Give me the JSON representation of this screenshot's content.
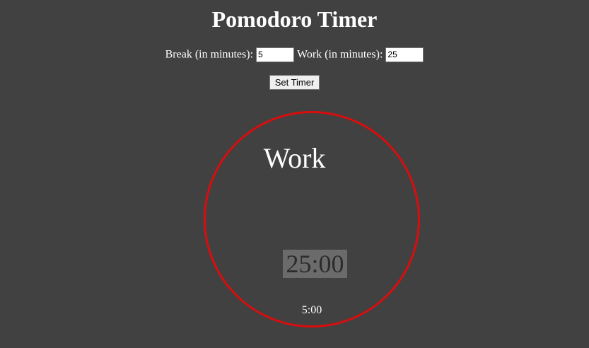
{
  "header": {
    "title": "Pomodoro Timer"
  },
  "settings": {
    "break_label": "Break (in minutes):",
    "break_value": "5",
    "work_label": "Work (in minutes):",
    "work_value": "25",
    "set_button_label": "Set Timer"
  },
  "timer": {
    "mode_label": "Work",
    "time_remaining": "25:00",
    "break_time": "5:00",
    "ring_color": "#d90d0d"
  },
  "colors": {
    "background": "#414141",
    "text": "#ffffff",
    "time_display_bg": "#6b6b6b"
  }
}
